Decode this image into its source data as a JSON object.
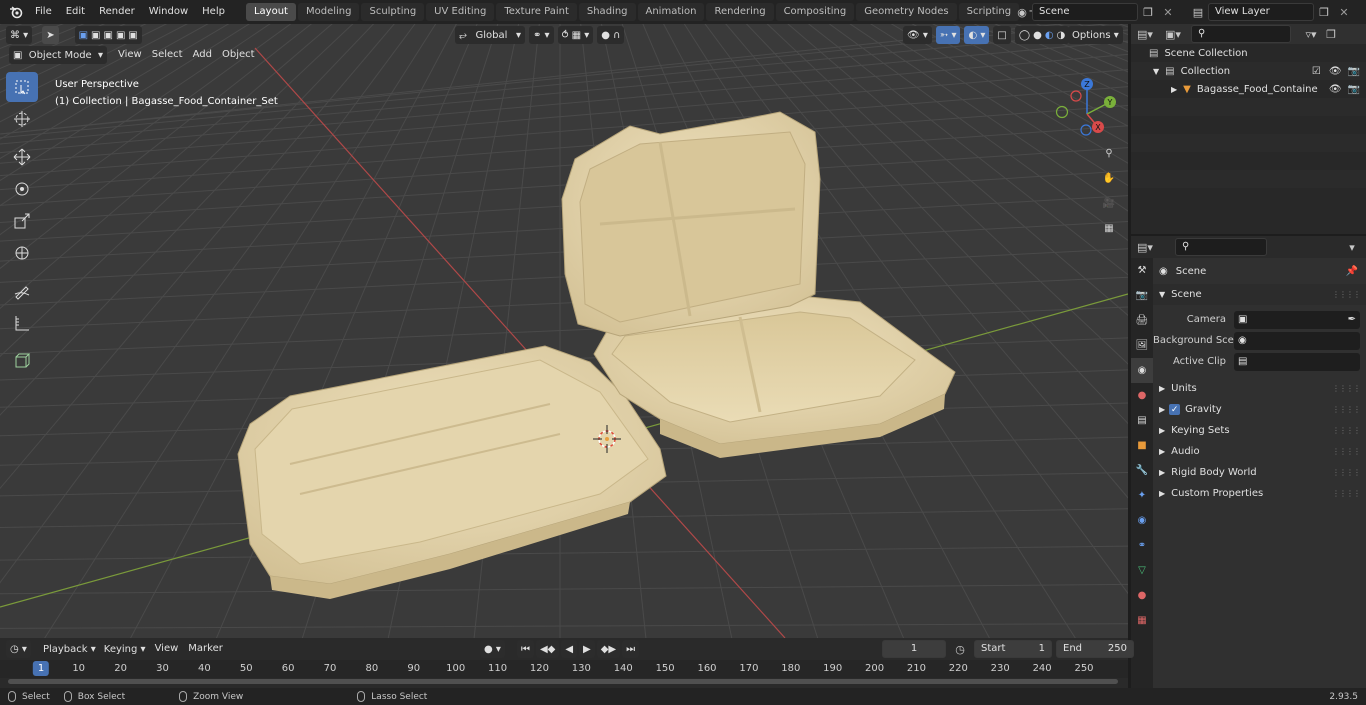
{
  "menubar": {
    "items": [
      "File",
      "Edit",
      "Render",
      "Window",
      "Help"
    ],
    "workspaces": [
      "Layout",
      "Modeling",
      "Sculpting",
      "UV Editing",
      "Texture Paint",
      "Shading",
      "Animation",
      "Rendering",
      "Compositing",
      "Geometry Nodes",
      "Scripting"
    ],
    "active_workspace": "Layout",
    "add_tab": "+",
    "scene_name": "Scene",
    "view_layer": "View Layer"
  },
  "viewport": {
    "mode": "Object Mode",
    "menus": [
      "View",
      "Select",
      "Add",
      "Object"
    ],
    "orientation": "Global",
    "options_label": "Options",
    "overlay_title": "User Perspective",
    "overlay_subtitle": "(1) Collection | Bagasse_Food_Container_Set",
    "gizmo_axes": {
      "z": "Z",
      "y": "Y",
      "x": "X"
    },
    "colors": {
      "background": "#3a3a3a",
      "grid": "#4a4a4a",
      "x_axis": "#b04848",
      "y_axis": "#7a9a3a",
      "container": "#e7d9b4"
    }
  },
  "toolbar": {
    "tools": [
      "select-box",
      "cursor",
      "move",
      "rotate",
      "scale",
      "transform",
      "annotate",
      "measure",
      "add-cube"
    ]
  },
  "outliner": {
    "search_placeholder": "",
    "rows": [
      {
        "label": "Scene Collection",
        "level": 0
      },
      {
        "label": "Collection",
        "level": 1
      },
      {
        "label": "Bagasse_Food_Containe",
        "level": 2
      }
    ]
  },
  "properties": {
    "context_title": "Scene",
    "panel_title": "Scene",
    "fields": [
      {
        "label": "Camera",
        "value": ""
      },
      {
        "label": "Background Scene",
        "value": ""
      },
      {
        "label": "Active Clip",
        "value": ""
      }
    ],
    "subpanels": [
      "Units",
      "Gravity",
      "Keying Sets",
      "Audio",
      "Rigid Body World",
      "Custom Properties"
    ],
    "gravity_checked": true
  },
  "timeline": {
    "menus": [
      "Playback",
      "Keying",
      "View",
      "Marker"
    ],
    "current_frame": "1",
    "start_label": "Start",
    "start": "1",
    "end_label": "End",
    "end": "250",
    "ticks": [
      "1",
      "10",
      "20",
      "30",
      "40",
      "50",
      "60",
      "70",
      "80",
      "90",
      "100",
      "110",
      "120",
      "130",
      "140",
      "150",
      "160",
      "170",
      "180",
      "190",
      "200",
      "210",
      "220",
      "230",
      "240",
      "250"
    ]
  },
  "statusbar": {
    "select": "Select",
    "box_select": "Box Select",
    "zoom_view": "Zoom View",
    "lasso_select": "Lasso Select",
    "version": "2.93.5"
  }
}
